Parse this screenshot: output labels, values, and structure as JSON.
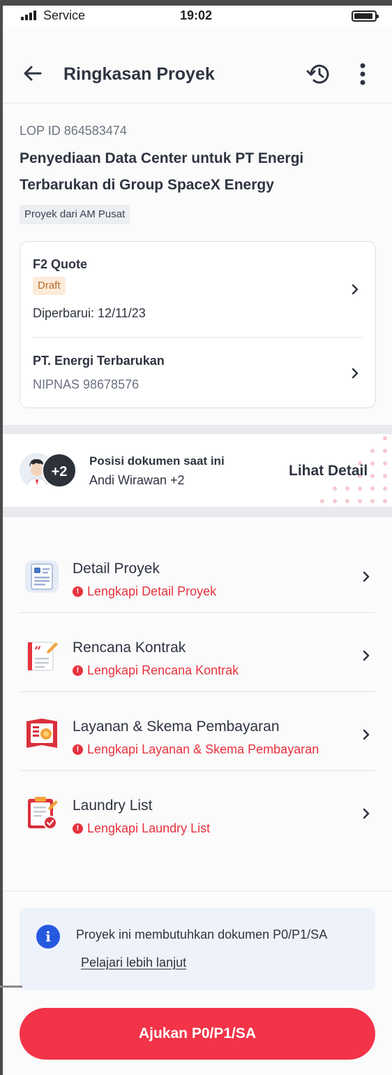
{
  "status_bar": {
    "carrier": "Service",
    "time": "19:02"
  },
  "app_bar": {
    "title": "Ringkasan Proyek"
  },
  "project": {
    "lop_id": "LOP ID 864583474",
    "title": "Penyediaan Data Center untuk PT Energi Terbarukan di Group SpaceX Energy",
    "tag": "Proyek dari AM Pusat"
  },
  "quote_card": {
    "quote_title": "F2 Quote",
    "status": "Draft",
    "updated": "Diperbarui: 12/11/23",
    "company": "PT. Energi Terbarukan",
    "nipnas": "NIPNAS 98678576"
  },
  "document_position": {
    "extra_count": "+2",
    "label": "Posisi dokumen saat ini",
    "holder": "Andi Wirawan +2",
    "detail_link": "Lihat Detail"
  },
  "menu": {
    "items": [
      {
        "title": "Detail Proyek",
        "warning": "Lengkapi Detail Proyek",
        "icon": "document-list-icon"
      },
      {
        "title": "Rencana Kontrak",
        "warning": "Lengkapi Rencana Kontrak",
        "icon": "contract-plan-icon"
      },
      {
        "title": "Layanan & Skema Pembayaran",
        "warning": "Lengkapi Layanan & Skema Pembayaran",
        "icon": "payment-scheme-icon"
      },
      {
        "title": "Laundry List",
        "warning": "Lengkapi Laundry List",
        "icon": "laundry-list-icon"
      }
    ]
  },
  "info_box": {
    "text": "Proyek ini membutuhkan dokumen P0/P1/SA",
    "link": "Pelajari lebih lanjut"
  },
  "cta": {
    "label": "Ajukan P0/P1/SA"
  },
  "colors": {
    "primary": "#f23348",
    "warning": "#e8313e",
    "info": "#2459e0",
    "draft_bg": "#fdebd9"
  }
}
